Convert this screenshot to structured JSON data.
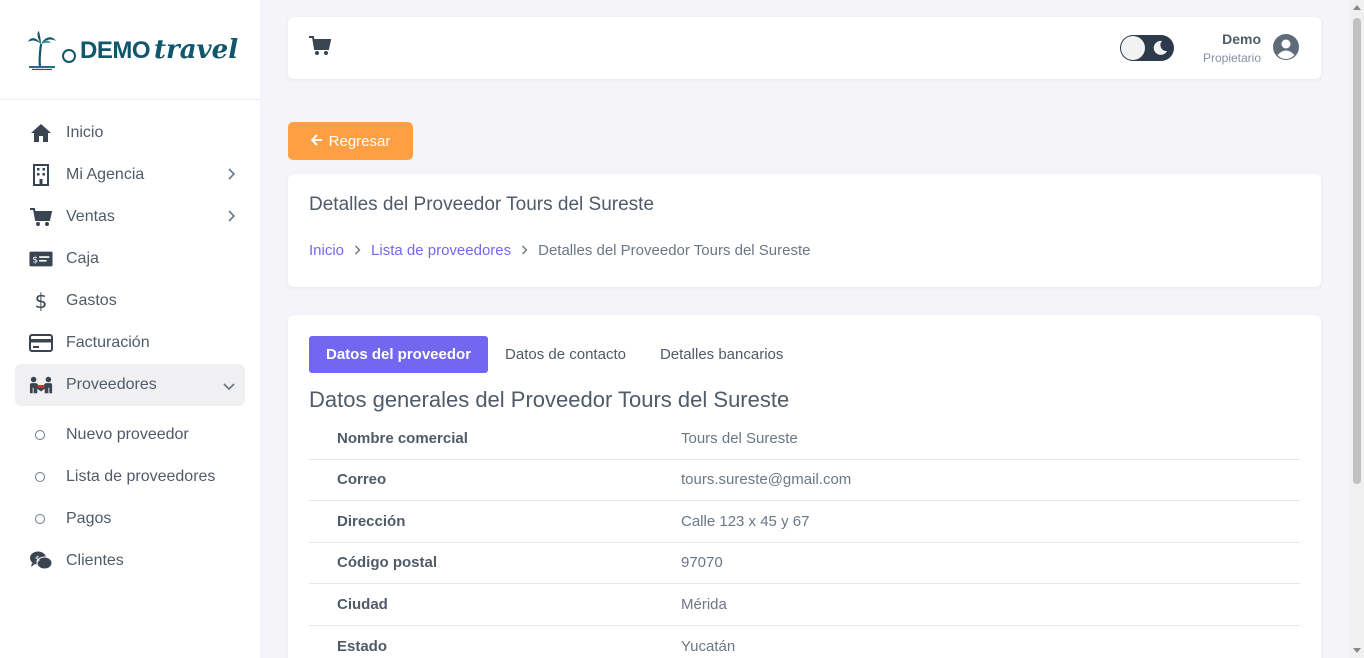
{
  "brand": {
    "demo": "DEMO",
    "travel": "travel"
  },
  "sidebar": {
    "items": [
      {
        "label": "Inicio",
        "icon": "home-icon"
      },
      {
        "label": "Mi Agencia",
        "icon": "building-icon"
      },
      {
        "label": "Ventas",
        "icon": "cart-icon"
      },
      {
        "label": "Caja",
        "icon": "cash-icon"
      },
      {
        "label": "Gastos",
        "icon": "dollar-icon"
      },
      {
        "label": "Facturación",
        "icon": "credit-card-icon"
      },
      {
        "label": "Proveedores",
        "icon": "people-icon"
      }
    ],
    "sub_items": [
      {
        "label": "Nuevo proveedor"
      },
      {
        "label": "Lista de proveedores"
      },
      {
        "label": "Pagos"
      }
    ],
    "after": [
      {
        "label": "Clientes",
        "icon": "clients-chat-icon"
      }
    ]
  },
  "user": {
    "name": "Demo",
    "role": "Propietario"
  },
  "back_button": {
    "label": "Regresar"
  },
  "header": {
    "title": "Detalles del Proveedor Tours del Sureste",
    "breadcrumb": {
      "home": "Inicio",
      "list": "Lista de proveedores",
      "current": "Detalles del Proveedor Tours del Sureste"
    }
  },
  "tabs": [
    "Datos del proveedor",
    "Datos de contacto",
    "Detalles bancarios"
  ],
  "section_title": "Datos generales del Proveedor Tours del Sureste",
  "rows": [
    {
      "label": "Nombre comercial",
      "value": "Tours del Sureste"
    },
    {
      "label": "Correo",
      "value": "tours.sureste@gmail.com"
    },
    {
      "label": "Dirección",
      "value": "Calle 123 x 45 y 67"
    },
    {
      "label": "Código postal",
      "value": "97070"
    },
    {
      "label": "Ciudad",
      "value": "Mérida"
    },
    {
      "label": "Estado",
      "value": "Yucatán"
    }
  ],
  "colors": {
    "primary": "#7367f0",
    "warning": "#ff9f43",
    "brand": "#12566b"
  }
}
